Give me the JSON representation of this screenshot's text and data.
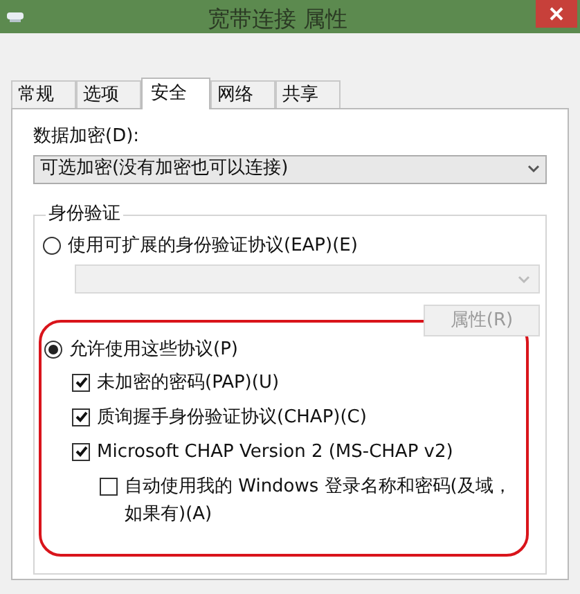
{
  "window": {
    "title": "宽带连接 属性"
  },
  "tabs": [
    {
      "label": "常规",
      "selected": false
    },
    {
      "label": "选项",
      "selected": false
    },
    {
      "label": "安全",
      "selected": true
    },
    {
      "label": "网络",
      "selected": false
    },
    {
      "label": "共享",
      "selected": false
    }
  ],
  "encryption": {
    "label": "数据加密(D):",
    "value": "可选加密(没有加密也可以连接)"
  },
  "authentication": {
    "title": "身份验证",
    "eap_option": {
      "label": "使用可扩展的身份验证协议(EAP)(E)",
      "selected": false
    },
    "eap_dropdown": {
      "disabled": true
    },
    "properties_button": {
      "label": "属性(R)",
      "disabled": true
    },
    "protocols_option": {
      "label": "允许使用这些协议(P)",
      "selected": true
    },
    "protocols": [
      {
        "label": "未加密的密码(PAP)(U)",
        "checked": true
      },
      {
        "label": "质询握手身份验证协议(CHAP)(C)",
        "checked": true
      },
      {
        "label": "Microsoft CHAP Version 2 (MS-CHAP v2)",
        "checked": true,
        "children": [
          {
            "label": "自动使用我的 Windows 登录名称和密码(及域，如果有)(A)",
            "checked": false
          }
        ]
      }
    ]
  }
}
